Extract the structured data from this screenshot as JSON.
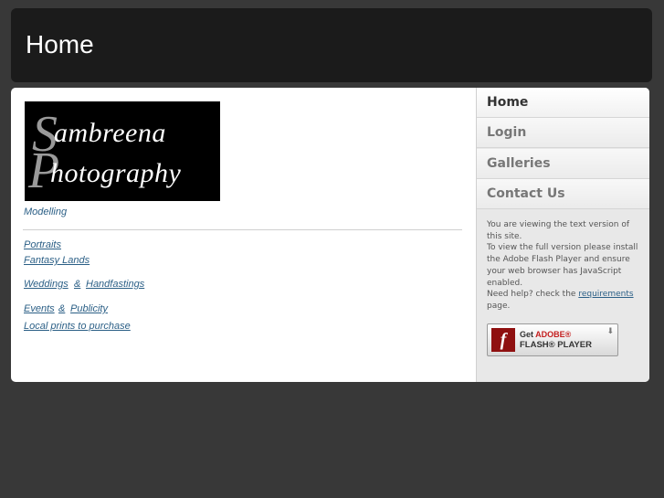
{
  "header": {
    "title": "Home"
  },
  "logo": {
    "cap_s": "S",
    "line1": "ambreena",
    "cap_p": "P",
    "line2": "hotography"
  },
  "content": {
    "modelling": "Modelling",
    "portraits": "Portraits",
    "fantasy_lands": "Fantasy Lands",
    "weddings": "Weddings",
    "amp1": "&",
    "handfastings": "Handfastings",
    "events": "Events",
    "amp2": "&",
    "publicity": "Publicity",
    "local_prints": "Local prints to purchase"
  },
  "nav": {
    "items": [
      {
        "label": "Home",
        "active": true
      },
      {
        "label": "Login"
      },
      {
        "label": "Galleries"
      },
      {
        "label": "Contact Us"
      }
    ]
  },
  "notice": {
    "line1": "You are viewing the text version of this site.",
    "line2": "To view the full version please install the Adobe Flash Player and ensure your web browser has JavaScript enabled.",
    "line3_pre": "Need help? check the ",
    "requirements": "requirements",
    "line3_post": " page."
  },
  "flash_button": {
    "icon_glyph": "f",
    "get": "Get ",
    "adobe": "ADOBE®",
    "player": "FLASH® PLAYER",
    "arrow": "⬇"
  },
  "colors": {
    "background": "#383838",
    "header": "#1b1b1b",
    "link": "#2b5f86"
  }
}
